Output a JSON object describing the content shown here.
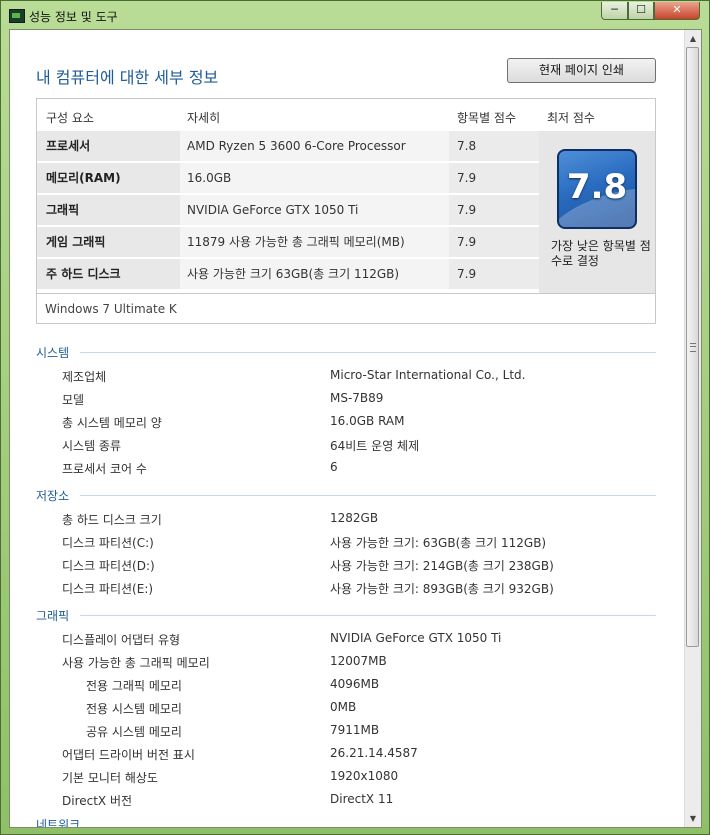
{
  "window": {
    "title": "성능 정보 및 도구",
    "controls": {
      "minimize": "─",
      "maximize": "☐",
      "close": "✕"
    }
  },
  "page": {
    "title": "내 컴퓨터에 대한 세부 정보",
    "print_button": "현재 페이지 인쇄"
  },
  "score_table": {
    "headers": {
      "component": "구성 요소",
      "details": "자세히",
      "subscore": "항목별 점수",
      "base": "최저 점수"
    },
    "rows": [
      {
        "component": "프로세서",
        "details": "AMD Ryzen 5 3600 6-Core Processor",
        "score": "7.8"
      },
      {
        "component": "메모리(RAM)",
        "details": "16.0GB",
        "score": "7.9"
      },
      {
        "component": "그래픽",
        "details": "NVIDIA GeForce GTX 1050 Ti",
        "score": "7.9"
      },
      {
        "component": "게임 그래픽",
        "details": "11879 사용 가능한 총 그래픽 메모리(MB)",
        "score": "7.9"
      },
      {
        "component": "주 하드 디스크",
        "details": "사용 가능한 크기 63GB(총 크기 112GB)",
        "score": "7.9"
      }
    ],
    "base_score": "7.8",
    "base_caption": "가장 낮은 항목별 점수로 결정",
    "os": "Windows 7 Ultimate K"
  },
  "sections": {
    "system": {
      "title": "시스템",
      "items": [
        {
          "label": "제조업체",
          "value": "Micro-Star International Co., Ltd."
        },
        {
          "label": "모델",
          "value": "MS-7B89"
        },
        {
          "label": "총 시스템 메모리 양",
          "value": "16.0GB RAM"
        },
        {
          "label": "시스템 종류",
          "value": "64비트 운영 체제"
        },
        {
          "label": "프로세서 코어 수",
          "value": "6"
        }
      ]
    },
    "storage": {
      "title": "저장소",
      "items": [
        {
          "label": "총 하드 디스크 크기",
          "value": "1282GB"
        },
        {
          "label": "디스크 파티션(C:)",
          "value": "사용 가능한 크기: 63GB(총 크기 112GB)"
        },
        {
          "label": "디스크 파티션(D:)",
          "value": "사용 가능한 크기: 214GB(총 크기 238GB)"
        },
        {
          "label": "디스크 파티션(E:)",
          "value": "사용 가능한 크기: 893GB(총 크기 932GB)"
        }
      ]
    },
    "graphics": {
      "title": "그래픽",
      "items": [
        {
          "label": "디스플레이 어댑터 유형",
          "value": "NVIDIA GeForce GTX 1050 Ti"
        },
        {
          "label": "사용 가능한 총 그래픽 메모리",
          "value": "12007MB"
        },
        {
          "label": "전용 그래픽 메모리",
          "value": "4096MB"
        },
        {
          "label": "전용 시스템 메모리",
          "value": "0MB"
        },
        {
          "label": "공유 시스템 메모리",
          "value": "7911MB"
        },
        {
          "label": "어댑터 드라이버 버전 표시",
          "value": "26.21.14.4587"
        },
        {
          "label": "기본 모니터 해상도",
          "value": "1920x1080"
        },
        {
          "label": "DirectX 버전",
          "value": "DirectX 11"
        }
      ]
    },
    "network": {
      "title": "네트워크"
    }
  },
  "scrollbar": {
    "up": "▲",
    "down": "▼"
  }
}
